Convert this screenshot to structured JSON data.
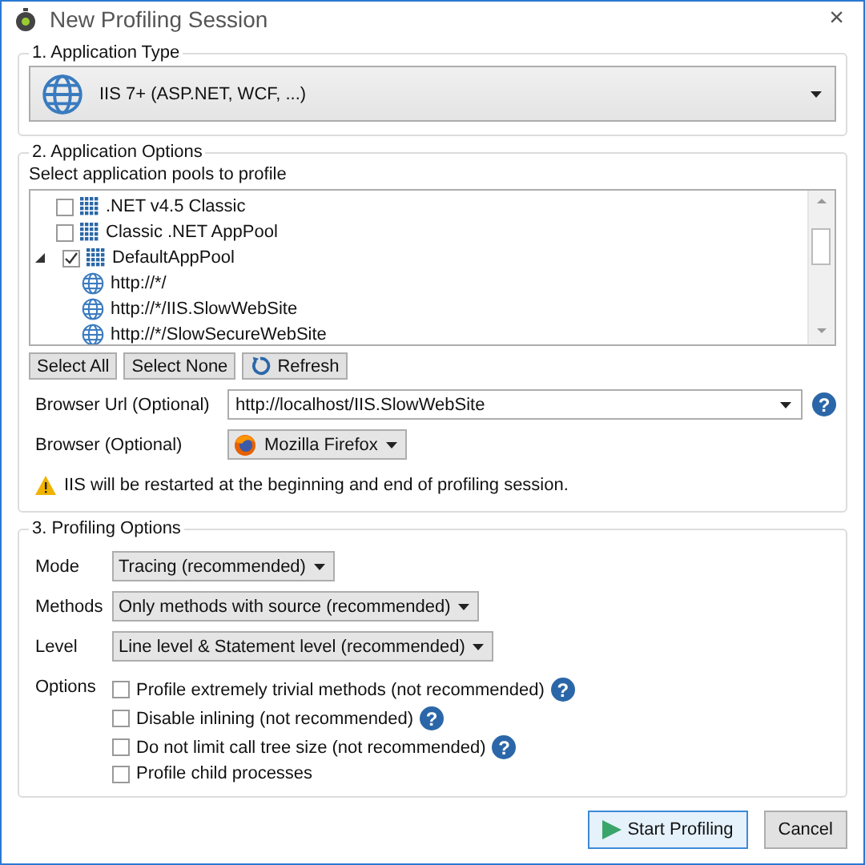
{
  "window": {
    "title": "New Profiling Session",
    "close": "×"
  },
  "application_type": {
    "legend": "1. Application Type",
    "value": "IIS 7+ (ASP.NET, WCF, ...)"
  },
  "application_options": {
    "legend": "2. Application Options",
    "pools_label": "Select application pools to profile",
    "pools": [
      {
        "label": ".NET v4.5 Classic",
        "checked": false
      },
      {
        "label": "Classic .NET AppPool",
        "checked": false
      },
      {
        "label": "DefaultAppPool",
        "checked": true,
        "expanded": true,
        "children": [
          {
            "label": "http://*/"
          },
          {
            "label": "http://*/IIS.SlowWebSite"
          },
          {
            "label": "http://*/SlowSecureWebSite"
          }
        ]
      }
    ],
    "buttons": [
      "Select All",
      "Select None",
      "Refresh"
    ],
    "browser_url": {
      "label": "Browser Url (Optional)",
      "value": "http://localhost/IIS.SlowWebSite",
      "help": "?"
    },
    "browser": {
      "label": "Browser (Optional)",
      "value": "Mozilla Firefox"
    },
    "warning": "IIS will be restarted at the beginning and end of profiling session."
  },
  "profiling_options": {
    "legend": "3. Profiling Options",
    "selects": [
      {
        "label": "Mode",
        "value": "Tracing (recommended)"
      },
      {
        "label": "Methods",
        "value": "Only methods with source (recommended)"
      },
      {
        "label": "Level",
        "value": "Line level & Statement level (recommended)"
      }
    ],
    "options_label": "Options",
    "options": [
      {
        "label": "Profile extremely trivial methods (not recommended)",
        "checked": false,
        "help": "?"
      },
      {
        "label": "Disable inlining (not recommended)",
        "checked": false,
        "help": "?"
      },
      {
        "label": "Do not limit call tree size (not recommended)",
        "checked": false,
        "help": "?"
      },
      {
        "label": "Profile child processes",
        "checked": false
      }
    ]
  },
  "footer": {
    "start": "Start Profiling",
    "cancel": "Cancel"
  }
}
